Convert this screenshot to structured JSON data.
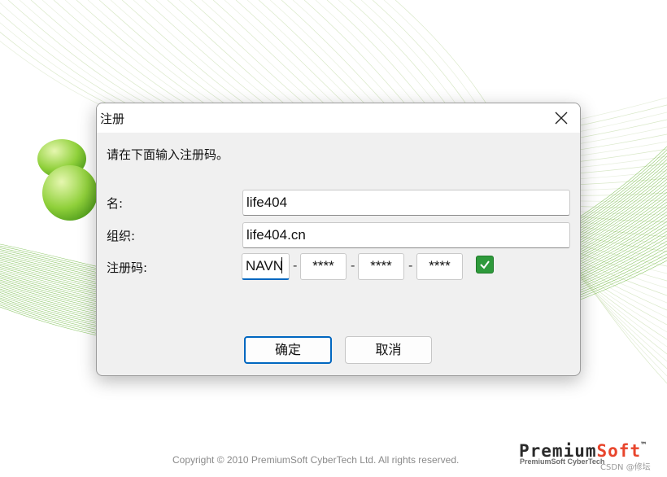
{
  "dialog": {
    "title": "注册",
    "instruction": "请在下面输入注册码。",
    "name_label": "名:",
    "name_value": "life404",
    "org_label": "组织:",
    "org_value": "life404.cn",
    "code_label": "注册码:",
    "code_segments": [
      "NAVN",
      "****",
      "****",
      "****"
    ],
    "code_separator": "-",
    "ok_label": "确定",
    "cancel_label": "取消"
  },
  "background": {
    "copyright": "Copyright © 2010 PremiumSoft CyberTech Ltd. All rights reserved.",
    "brand_main": "Premium",
    "brand_accent": "Soft",
    "brand_tm": "™",
    "brand_sub": "PremiumSoft CyberTech",
    "watermark": "CSDN @修坛"
  },
  "colors": {
    "accent": "#0067c0",
    "check_green": "#2e9a3b",
    "brand_orange": "#e8452c",
    "curve_green": "#7fc24a"
  },
  "icons": [
    "close-icon",
    "checkmark-icon",
    "navicat-logo-icon"
  ]
}
